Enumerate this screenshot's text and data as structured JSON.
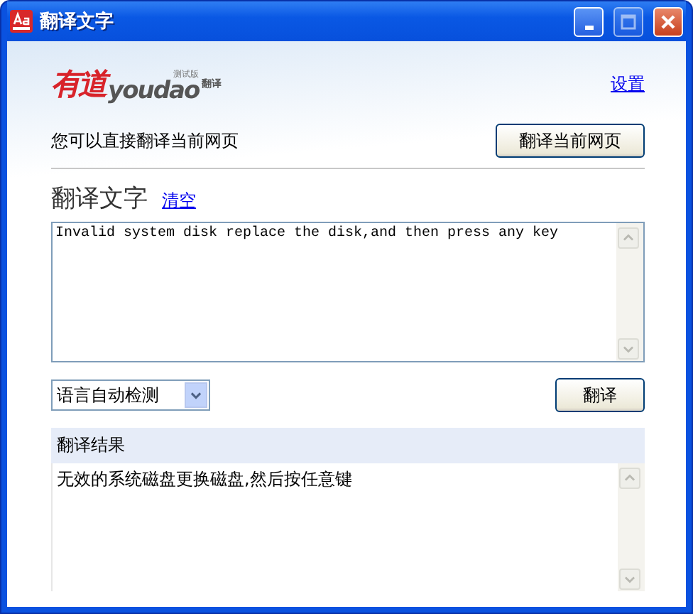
{
  "window": {
    "title": "翻译文字"
  },
  "logo": {
    "brand_cn": "有道",
    "brand_en": "youdao",
    "badge": "测试版",
    "product": "翻译"
  },
  "settings_link": "设置",
  "page_hint": "您可以直接翻译当前网页",
  "translate_page_button": "翻译当前网页",
  "source": {
    "heading": "翻译文字",
    "clear_link": "清空",
    "value": "Invalid system disk replace the disk,and then press any key"
  },
  "language_select": {
    "value": "语言自动检测"
  },
  "translate_button": "翻译",
  "result": {
    "heading": "翻译结果",
    "text": "无效的系统磁盘更换磁盘,然后按任意键"
  }
}
